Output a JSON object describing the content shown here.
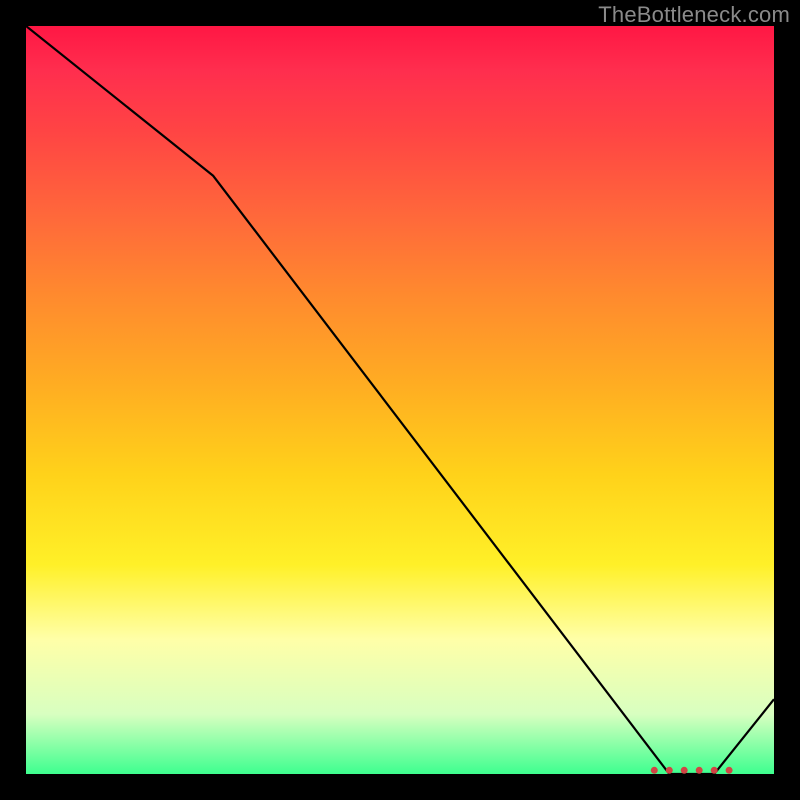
{
  "watermark": "TheBottleneck.com",
  "chart_data": {
    "type": "line",
    "title": "",
    "xlabel": "",
    "ylabel": "",
    "xlim": [
      0,
      100
    ],
    "ylim": [
      0,
      100
    ],
    "series": [
      {
        "name": "curve",
        "x": [
          0,
          25,
          86,
          92,
          100
        ],
        "values": [
          100,
          80,
          0,
          0,
          10
        ]
      }
    ],
    "markers": {
      "x": [
        84,
        86,
        88,
        90,
        92,
        94
      ],
      "values": [
        0.5,
        0.5,
        0.5,
        0.5,
        0.5,
        0.5
      ],
      "color": "#d24444"
    },
    "gradient": {
      "top": "#ff1744",
      "mid": "#ffd400",
      "low": "#ffffa0",
      "bottom": "#3eff8f"
    }
  }
}
